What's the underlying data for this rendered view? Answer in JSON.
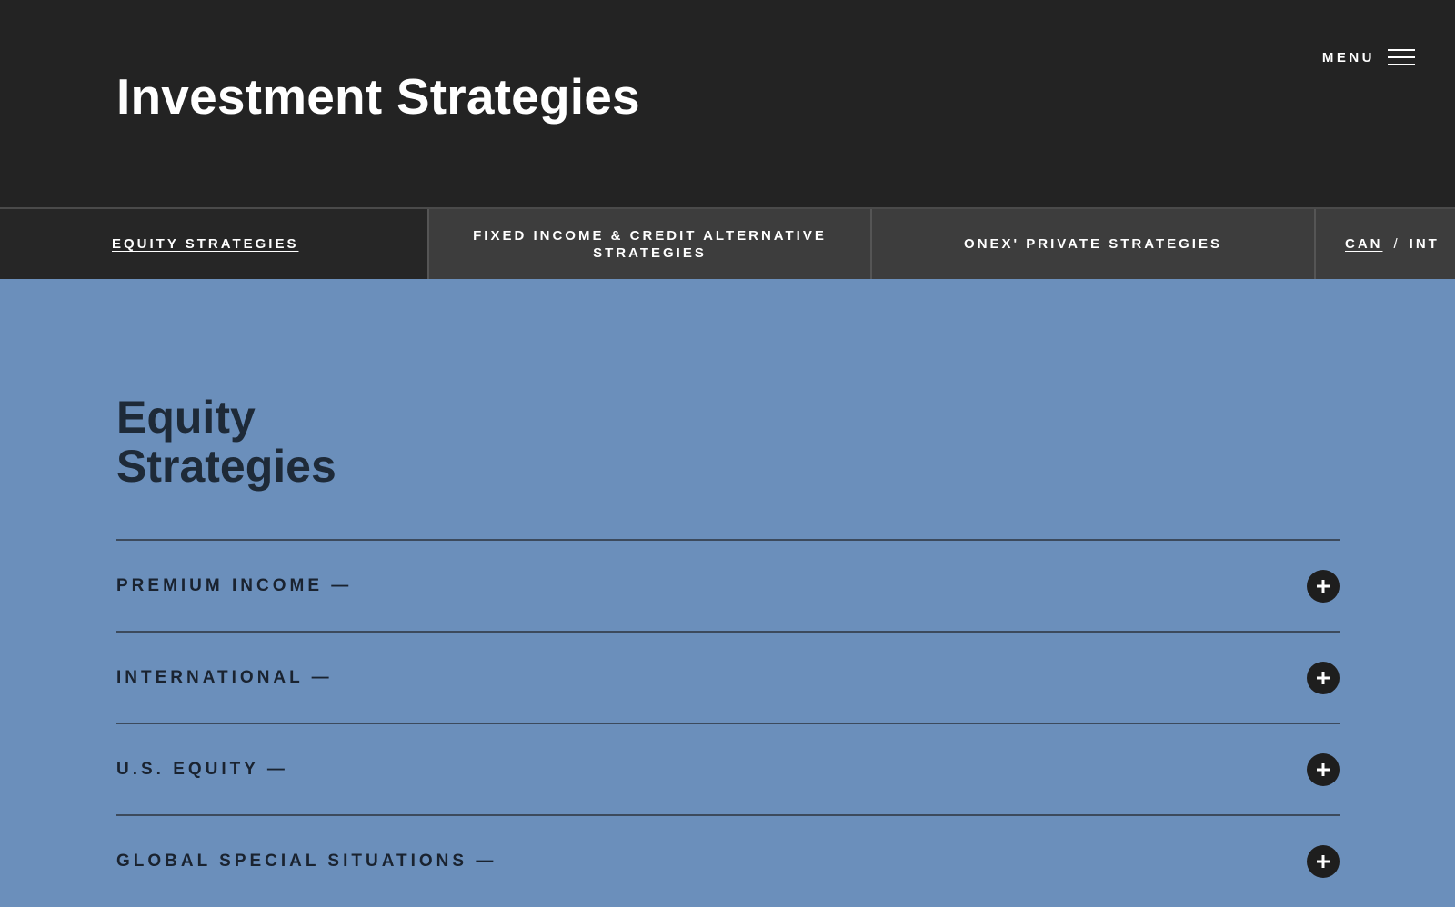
{
  "header": {
    "title": "Investment Strategies",
    "menu_label": "MENU",
    "menu_icon": "hamburger-icon"
  },
  "tabs": [
    {
      "label": "EQUITY STRATEGIES",
      "active": true
    },
    {
      "label": "FIXED INCOME & CREDIT ALTERNATIVE STRATEGIES",
      "active": false
    },
    {
      "label": "ONEX' PRIVATE STRATEGIES",
      "active": false
    }
  ],
  "region": {
    "can": "CAN",
    "separator": "/",
    "int": "INT",
    "selected": "CAN"
  },
  "section": {
    "title_line1": "Equity",
    "title_line2": "Strategies"
  },
  "accordion": {
    "expand_icon": "plus-icon",
    "items": [
      {
        "label": "PREMIUM INCOME —"
      },
      {
        "label": "INTERNATIONAL —"
      },
      {
        "label": "U.S. EQUITY —"
      },
      {
        "label": "GLOBAL SPECIAL SITUATIONS —"
      }
    ]
  },
  "colors": {
    "header_bg": "#232323",
    "tab_active_bg": "#262626",
    "tab_bg": "#3d3d3d",
    "content_bg": "#6b8fbb",
    "text_dark": "#1a2330"
  }
}
